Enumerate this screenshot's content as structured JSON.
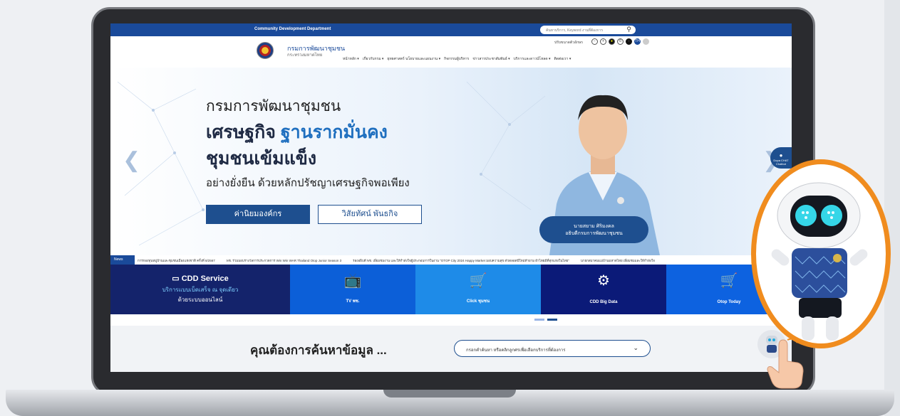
{
  "topbar": {
    "department": "Community Development Department",
    "search_placeholder": "ค้นหาบริการ, Keyword งานที่ต้องการ",
    "search_icon": "search-icon"
  },
  "header": {
    "brand_name": "กรมการพัฒนาชุมชน",
    "brand_sub": "กระทรวงมหาดไทย",
    "accessibility_label": "ปรับขนาดตัวอักษร",
    "access_buttons": [
      "−",
      "+",
      "●",
      "©",
      "●",
      "TH",
      ""
    ],
    "nav": [
      "หน้าหลัก ▾",
      "เกี่ยวกับกรม ▾",
      "ยุทธศาสตร์ นโยบายและแผนงาน ▾",
      "กิจกรรมผู้บริหาร",
      "ข่าวสารประชาสัมพันธ์ ▾",
      "บริการและดาวน์โหลด ▾",
      "ติดต่อเรา ▾"
    ]
  },
  "hero": {
    "line1": "กรมการพัฒนาชุมชน",
    "line2_a": "เศรษฐกิจ ",
    "line2_b": "ฐานรากมั่นคง",
    "line3": "ชุมชนเข้มแข็ง",
    "line4": "อย่างยั่งยืน ด้วยหลักปรัชญาเศรษฐกิจพอเพียง",
    "btn_values": "ค่านิยมองค์กร",
    "btn_vision": "วิสัยทัศน์ พันธกิจ",
    "caption_name": "นายสยาม ศิริมงคล",
    "caption_title": "อธิบดีกรมการพัฒนาชุมชน",
    "chat_label": "Dopa CHAT",
    "chat_sub": "Chatbot"
  },
  "news": {
    "label": "News",
    "items": [
      "การกองทุนหมู่บ้านและชุมชนเมืองแห่งชาติ ครั้งที่ 8/2567",
      "พช. ร่วมมอบรางวัลการประกวดการ Win Win WAR Thailand Otop Junior Season 3",
      "รองอธิบดี พช. เยี่ยมชมงาน และให้กำลังใจผู้ประกอบการในงาน \"OTOP City 2024 Happy Market มอบความสุข ตัวตลอดปีใหม่ท้ายาม ผ้าไทยมีที่ทุกแห่งในไทย\"",
      "นายกสมาคมแม่บ้านมหาดไทย เยี่ยมชมและให้กำลังใจ"
    ]
  },
  "services": {
    "main_title": "CDD Service",
    "main_sub1": "บริการแบบเบ็ดเสร็จ ณ จุดเดียว",
    "main_sub2": "ด้วยระบบออนไลน์",
    "items": [
      {
        "label": "TV พช.",
        "icon": "tv-icon",
        "color": "#0c5fd8"
      },
      {
        "label": "Click ชุมชน",
        "icon": "shop-icon",
        "color": "#1e8be8"
      },
      {
        "label": "CDD Big Data",
        "icon": "data-icon",
        "color": "#0b1a78"
      },
      {
        "label": "Otop Today",
        "icon": "cart-icon",
        "color": "#0d62e0"
      }
    ]
  },
  "find": {
    "title": "คุณต้องการค้นหาข้อมูล ...",
    "select_placeholder": "กรอกคำค้นหา หรือคลิกลูกศรเพื่อเลือกบริการที่ต้องการ"
  },
  "colors": {
    "brand_blue": "#1a4a9a",
    "accent_orange": "#f08c1e"
  }
}
